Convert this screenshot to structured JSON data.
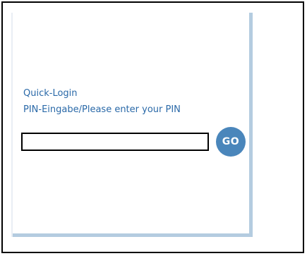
{
  "login": {
    "quick_login_label": "Quick-Login",
    "pin_prompt": "PIN-Eingabe/Please enter your PIN",
    "pin_value": "",
    "go_label": "GO"
  },
  "colors": {
    "text_blue": "#2a69a8",
    "button_blue": "#4a86bb",
    "panel_border": "#b4cce0"
  }
}
